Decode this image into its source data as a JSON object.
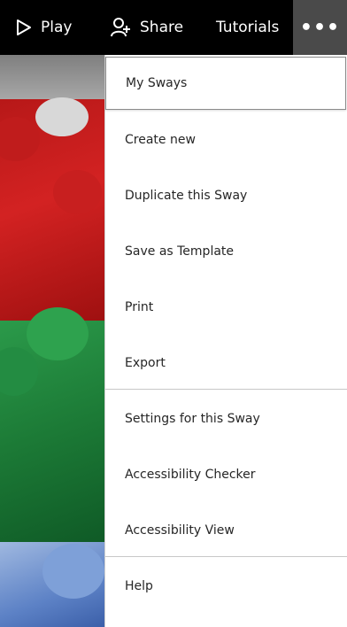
{
  "toolbar": {
    "play_label": "Play",
    "share_label": "Share",
    "tutorials_label": "Tutorials",
    "more_label": "•••",
    "icons": {
      "play": "play-icon",
      "share": "share-icon"
    }
  },
  "menu": {
    "items": [
      {
        "label": "My Sways",
        "selected": true
      },
      {
        "label": "Create new"
      },
      {
        "label": "Duplicate this Sway"
      },
      {
        "label": "Save as Template"
      },
      {
        "label": "Print"
      },
      {
        "label": "Export"
      },
      {
        "label": "Settings for this Sway"
      },
      {
        "label": "Accessibility Checker"
      },
      {
        "label": "Accessibility View"
      },
      {
        "label": "Help"
      }
    ]
  },
  "colors": {
    "topbar_bg": "#000000",
    "more_bg": "#4a4a4a",
    "menu_bg": "#ffffff",
    "text": "#262626"
  }
}
